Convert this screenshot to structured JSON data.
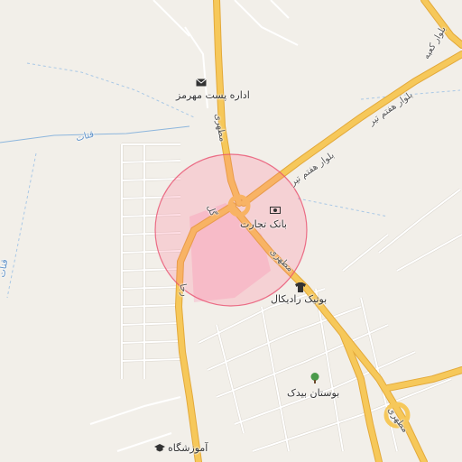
{
  "map": {
    "colors": {
      "background": "#f2efe9",
      "major_road": "#f6c85a",
      "major_road_casing": "#e3a93a",
      "minor_road": "#ffffff",
      "minor_road_casing": "#d9d4cc",
      "water_line": "#8db6dd",
      "radius_fill": "#ff6b8a",
      "radius_stroke": "#e8506f"
    },
    "pois": {
      "post_office": {
        "label": "اداره پست مهرمز",
        "icon": "envelope-icon"
      },
      "bank": {
        "label": "بانک تجارت",
        "icon": "banknote-icon"
      },
      "boutique": {
        "label": "بوتیک رادیکال",
        "icon": "tshirt-icon"
      },
      "park": {
        "label": "بوستان بیدک",
        "icon": "tree-icon"
      },
      "school": {
        "label": "آموزشگاه",
        "icon": "graduation-cap-icon"
      }
    },
    "roads": {
      "boulevard_haftom_tir_1": "بلوار هفتم تیر",
      "boulevard_haftom_tir_2": "بلوار هفتم تیر",
      "boulevard_kabe": "بلوار کعبه",
      "motahari_1": "مطهری",
      "motahari_2": "مطهری",
      "motahari_3": "مطهری",
      "gol": "گل",
      "raja": "رجا"
    },
    "water": {
      "qanat_1": "قنات",
      "qanat_2": "قنات"
    }
  }
}
